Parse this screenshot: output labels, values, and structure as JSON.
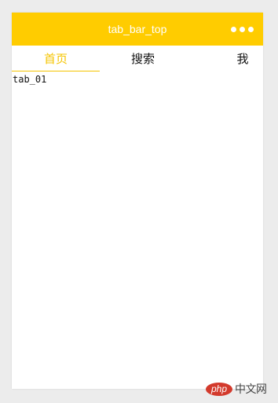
{
  "navbar": {
    "title": "tab_bar_top",
    "background": "#ffcc00",
    "menu_icon": "more-dots-icon"
  },
  "tabs": [
    {
      "label": "首页",
      "active": true
    },
    {
      "label": "搜索",
      "active": false
    },
    {
      "label": "我",
      "active": false
    }
  ],
  "active_color": "#f5c400",
  "content": {
    "text": "tab_01"
  },
  "watermark": {
    "logo_text": "php",
    "text": "中文网"
  }
}
